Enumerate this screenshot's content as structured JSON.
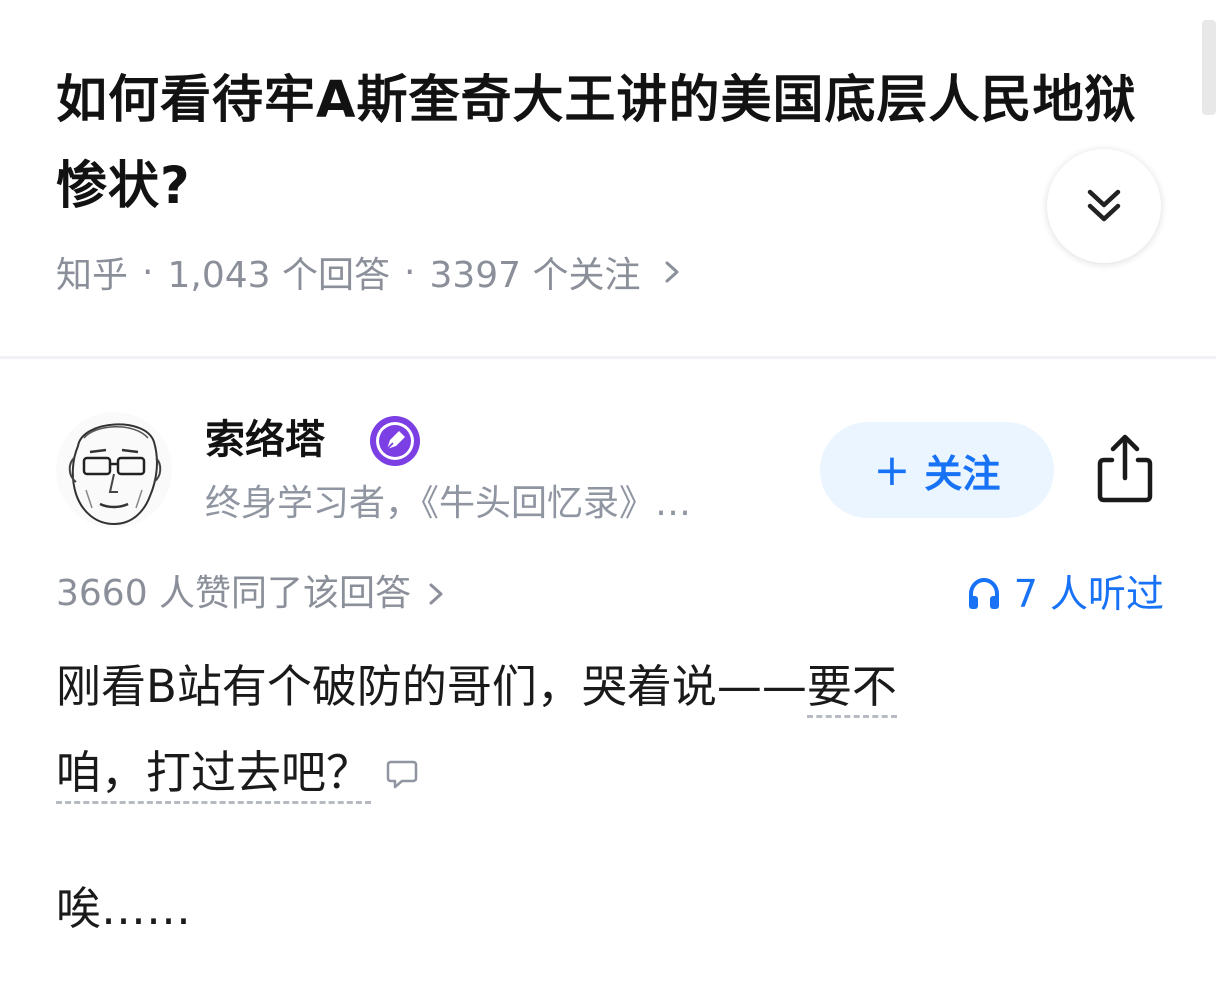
{
  "question": {
    "title": "如何看待牢A斯奎奇大王讲的美国底层人民地狱惨状?",
    "source": "知乎",
    "answers": "1,043 个回答",
    "followers": "3397 个关注"
  },
  "author": {
    "name": "索络塔",
    "bio": "终身学习者，《牛头回忆录》…",
    "follow_label": "关注"
  },
  "answer": {
    "votes": "3660 人赞同了该回答",
    "listeners": "7 人听过",
    "para1_plain": "刚看B站有个破防的哥们，哭着说——",
    "para1_marked_a": "要不",
    "para1_marked_b": "咱，打过去吧？",
    "para2": "唉……"
  },
  "colors": {
    "accent": "#1772f6",
    "follow_bg": "#ebf5ff",
    "meta_gray": "#8a8f99",
    "badge_purple": "#7b3fe4"
  },
  "icons": [
    "chevrons-down-icon",
    "chevron-right-icon",
    "creator-badge-icon",
    "share-icon",
    "headphones-icon",
    "comment-icon"
  ]
}
